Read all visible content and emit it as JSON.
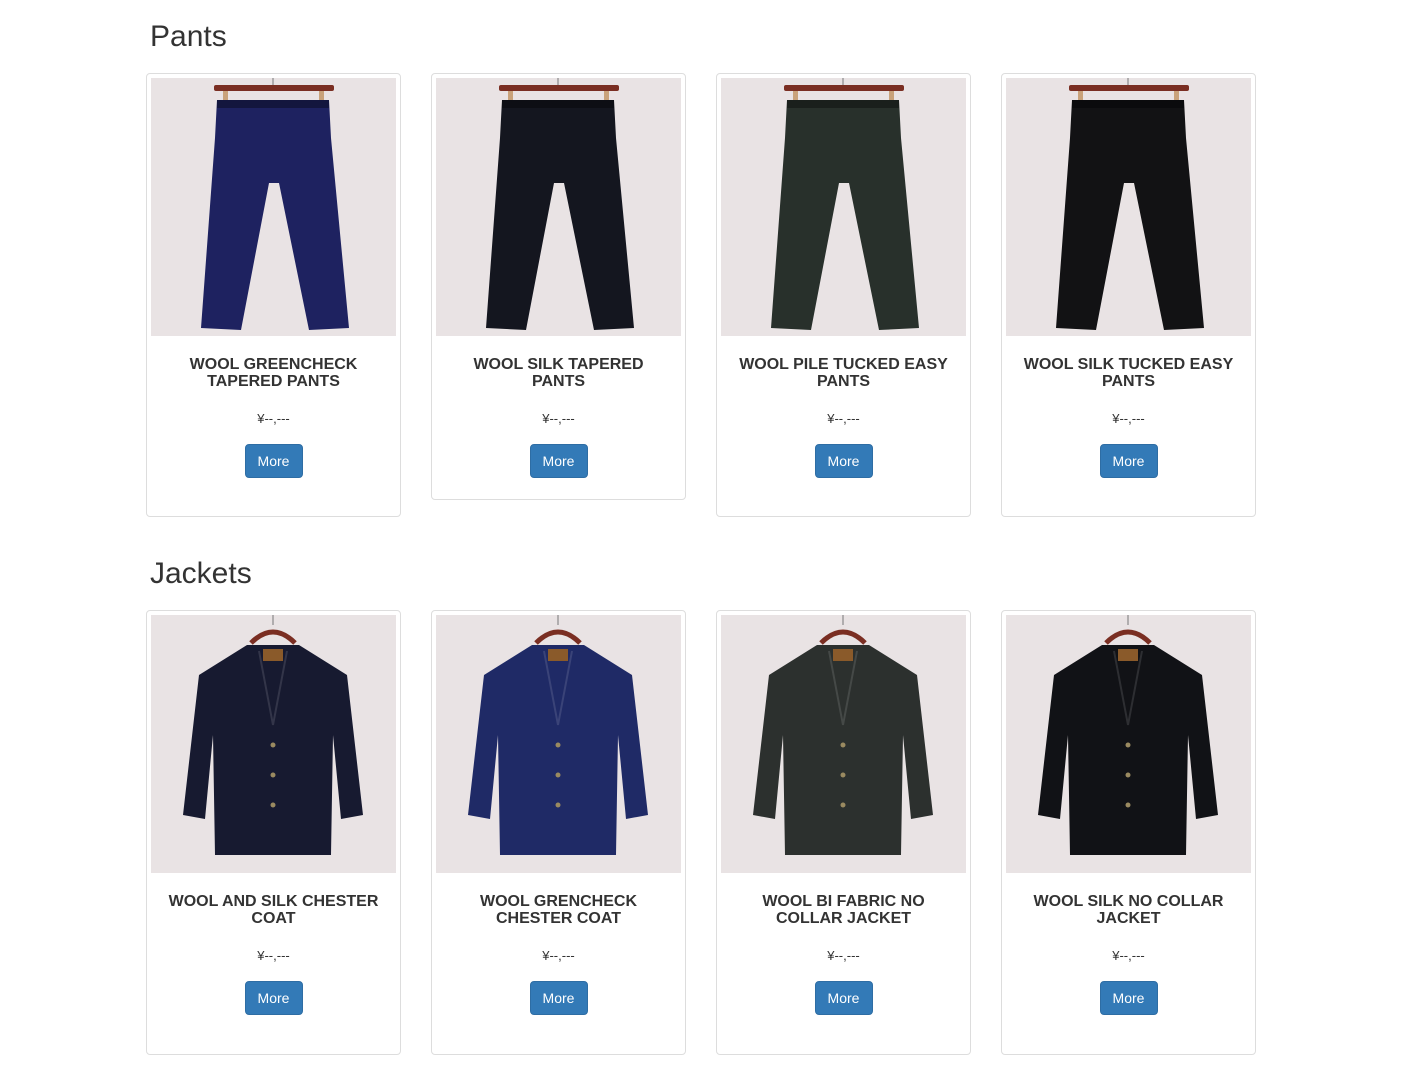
{
  "sections": {
    "pants": {
      "title": "Pants",
      "products": [
        {
          "name": "WOOL GREENCHECK TAPERED PANTS",
          "price": "¥--,---",
          "button": "More",
          "color": "#1e2260"
        },
        {
          "name": "WOOL SILK TAPERED PANTS",
          "price": "¥--,---",
          "button": "More",
          "color": "#14161f"
        },
        {
          "name": "WOOL PILE TUCKED EASY PANTS",
          "price": "¥--,---",
          "button": "More",
          "color": "#28302b"
        },
        {
          "name": "WOOL SILK TUCKED EASY PANTS",
          "price": "¥--,---",
          "button": "More",
          "color": "#121214"
        }
      ]
    },
    "jackets": {
      "title": "Jackets",
      "products": [
        {
          "name": "WOOL AND SILK CHESTER COAT",
          "price": "¥--,---",
          "button": "More",
          "color": "#171a30"
        },
        {
          "name": "WOOL GRENCHECK CHESTER COAT",
          "price": "¥--,---",
          "button": "More",
          "color": "#1f2a66"
        },
        {
          "name": "WOOL BI FABRIC NO COLLAR JACKET",
          "price": "¥--,---",
          "button": "More",
          "color": "#2c302e"
        },
        {
          "name": "WOOL SILK NO COLLAR JACKET",
          "price": "¥--,---",
          "button": "More",
          "color": "#111216"
        }
      ]
    }
  },
  "colors": {
    "button_bg": "#337ab7",
    "photo_bg": "#e9e3e4",
    "hanger": "#7a2e22"
  }
}
